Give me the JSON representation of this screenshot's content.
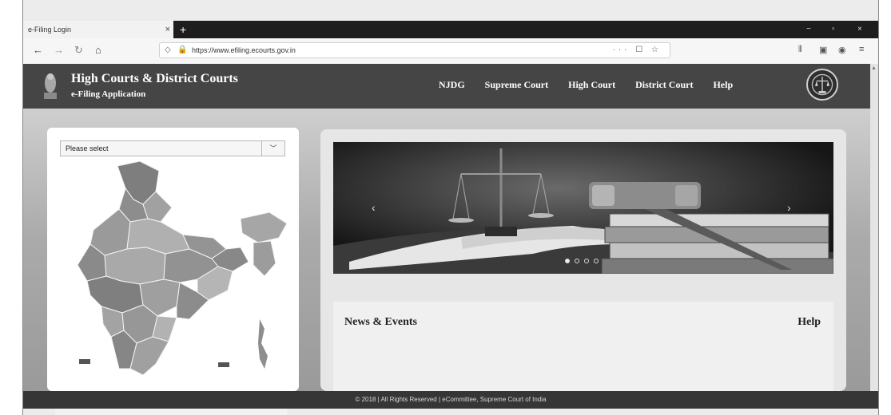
{
  "browser": {
    "tab_title": "e-Filing Login",
    "tab_close": "×",
    "new_tab": "+",
    "url": "https://www.efiling.ecourts.gov.in",
    "url_actions": "··· ☐ ☆",
    "window_controls": [
      "−",
      "▫",
      "×"
    ]
  },
  "header": {
    "title": "High Courts & District Courts",
    "subtitle": "e-Filing Application",
    "nav": [
      "NJDG",
      "Supreme Court",
      "High Court",
      "District Court",
      "Help"
    ]
  },
  "state_select": {
    "selected": "Please select"
  },
  "carousel": {
    "prev": "‹",
    "next": "›",
    "slides": 4,
    "active_slide": 0
  },
  "news": {
    "title": "News & Events",
    "help": "Help"
  },
  "footer": {
    "text": "© 2018 | All Rights Reserved | eCommittee, Supreme Court of India"
  },
  "icons": {
    "back": "back-arrow-icon",
    "forward": "forward-arrow-icon",
    "reload": "reload-icon",
    "home": "home-icon",
    "lock": "lock-icon",
    "shield": "shield-icon",
    "library": "library-icon",
    "sidebar": "sidebar-icon",
    "menu": "menu-icon"
  },
  "colors": {
    "header_bg": "#454545",
    "footer_bg": "#363636",
    "page_bg": "#b4b4b4"
  }
}
